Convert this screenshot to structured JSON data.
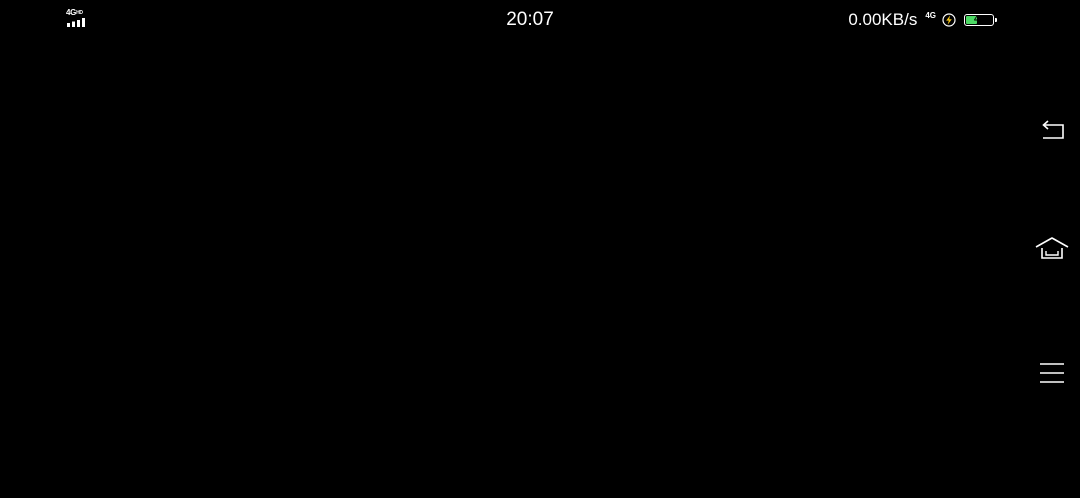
{
  "status_bar": {
    "network_type": "4G",
    "network_badge": "HD",
    "time": "20:07",
    "net_speed": "0.00KB/s",
    "volte_label": "4G",
    "battery_level": "42",
    "battery_fraction": 0.42,
    "battery_color": "#4cd964",
    "charging_icon": "lightning-bolt-icon"
  },
  "nav_bar": {
    "back_icon": "back-arrow-icon",
    "home_icon": "home-icon",
    "menu_icon": "menu-icon"
  },
  "colors": {
    "background": "#000000",
    "foreground": "#ffffff"
  }
}
